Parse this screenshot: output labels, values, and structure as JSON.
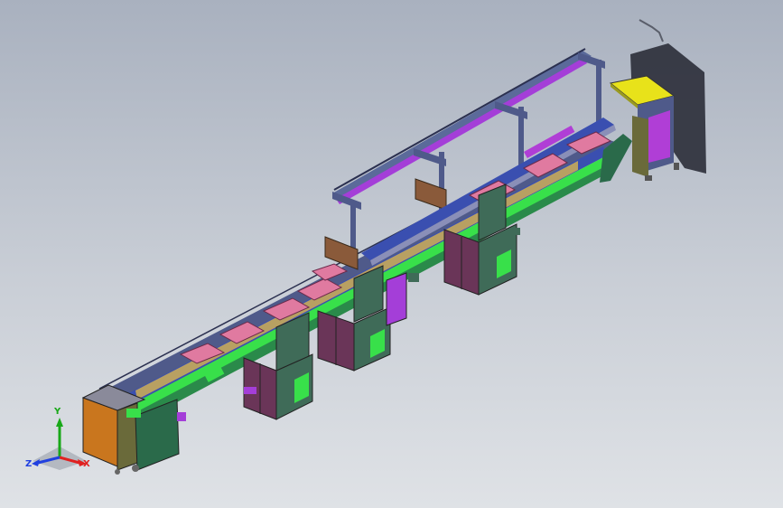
{
  "viewport": {
    "colors": {
      "bg_top": "#a9b1bf",
      "bg_bottom": "#dfe2e6",
      "frame": "#4f5a8a",
      "rail_purple": "#a43ed8",
      "conveyor_blue": "#3a4fb0",
      "cabinet_green": "#3f6b58",
      "cabinet_maroon": "#6a3558",
      "panel_orange": "#c9761e",
      "panel_yellow": "#e8e21a",
      "panel_purple": "#b03ed6",
      "fixture_pink": "#e07aa0",
      "bright_green": "#38e04a",
      "shadow": "#2b2e38"
    }
  },
  "triad": {
    "x_label": "X",
    "y_label": "Y",
    "z_label": "Z",
    "x_color": "#e02020",
    "y_color": "#18a818",
    "z_color": "#2040e0"
  }
}
